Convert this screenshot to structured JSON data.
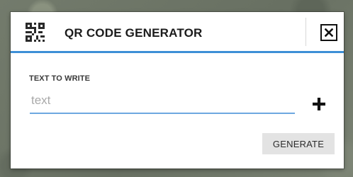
{
  "dialog": {
    "title": "QR CODE GENERATOR",
    "icons": {
      "app": "qr-code-icon",
      "close": "close-icon",
      "add": "plus-icon"
    }
  },
  "form": {
    "label": "TEXT TO WRITE",
    "input_value": "",
    "input_placeholder": "text",
    "generate_label": "GENERATE"
  },
  "colors": {
    "accent": "#3d8fd6",
    "underline": "#6ea8e0",
    "button_bg": "#e3e3e3"
  }
}
